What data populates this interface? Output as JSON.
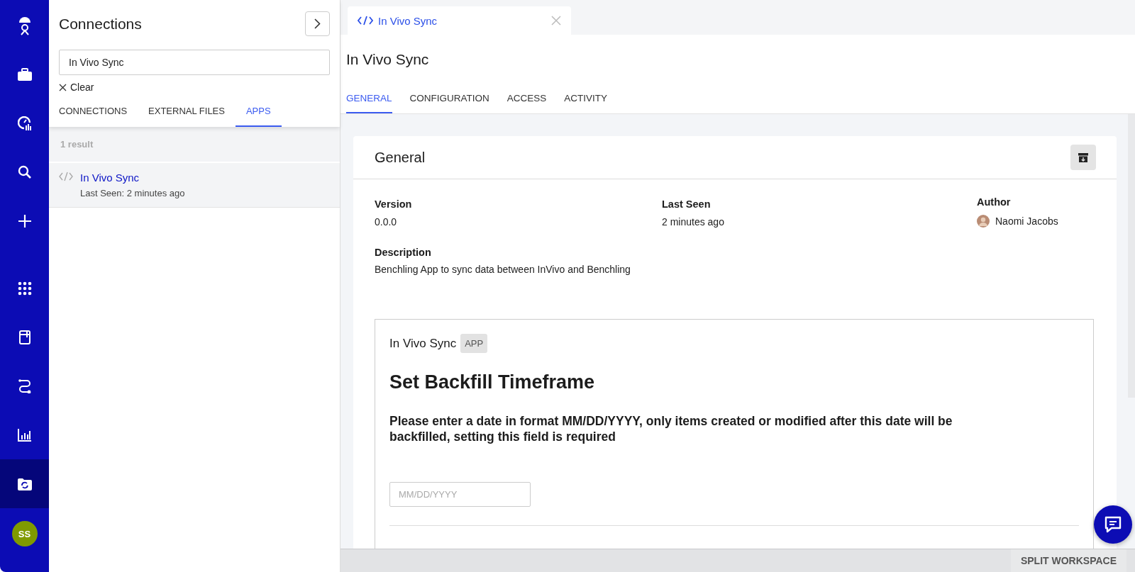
{
  "nav": {
    "items": [
      {
        "kind": "logo",
        "selected": false
      },
      {
        "kind": "briefcase",
        "selected": false
      },
      {
        "kind": "dashboard",
        "selected": false
      },
      {
        "kind": "search",
        "selected": false
      },
      {
        "kind": "plus",
        "selected": false
      },
      {
        "kind": "apps",
        "selected": false
      },
      {
        "kind": "notebook",
        "selected": false
      },
      {
        "kind": "workflow",
        "selected": false
      },
      {
        "kind": "chart",
        "selected": false
      },
      {
        "kind": "sync-folder",
        "selected": true
      }
    ],
    "avatar": "SS"
  },
  "panel": {
    "title": "Connections",
    "search": {
      "value": "In Vivo Sync"
    },
    "clear": "Clear",
    "tabs": [
      {
        "label": "CONNECTIONS",
        "selected": false
      },
      {
        "label": "EXTERNAL FILES",
        "selected": false
      },
      {
        "label": "APPS",
        "selected": true
      }
    ],
    "result_count": "1 result",
    "results": [
      {
        "name": "In Vivo Sync",
        "detail": "Last Seen: 2 minutes ago",
        "selected": true
      }
    ]
  },
  "doc_tab": {
    "label": "In Vivo Sync"
  },
  "header": {
    "title": "In Vivo Sync",
    "tabs": [
      {
        "label": "GENERAL",
        "selected": true
      },
      {
        "label": "CONFIGURATION",
        "selected": false
      },
      {
        "label": "ACCESS",
        "selected": false
      },
      {
        "label": "ACTIVITY",
        "selected": false
      }
    ]
  },
  "general": {
    "title": "General",
    "fields": [
      {
        "label": "Version",
        "value": "0.0.0"
      },
      {
        "label": "Last Seen",
        "value": "2 minutes ago"
      }
    ],
    "author": {
      "label": "Author",
      "name": "Naomi Jacobs"
    },
    "description": {
      "label": "Description",
      "value": "Benchling App to sync data between InVivo and Benchling"
    },
    "app_view": {
      "name": "In Vivo Sync",
      "badge": "APP",
      "heading": "Set Backfill Timeframe",
      "text": "Please enter a date in format MM/DD/YYYY, only items created or modified after this date will be backfilled, setting this field is required",
      "date_field": {
        "placeholder": "MM/DD/YYYY"
      }
    }
  },
  "status_bar": {
    "button": "SPLIT WORKSPACE"
  }
}
